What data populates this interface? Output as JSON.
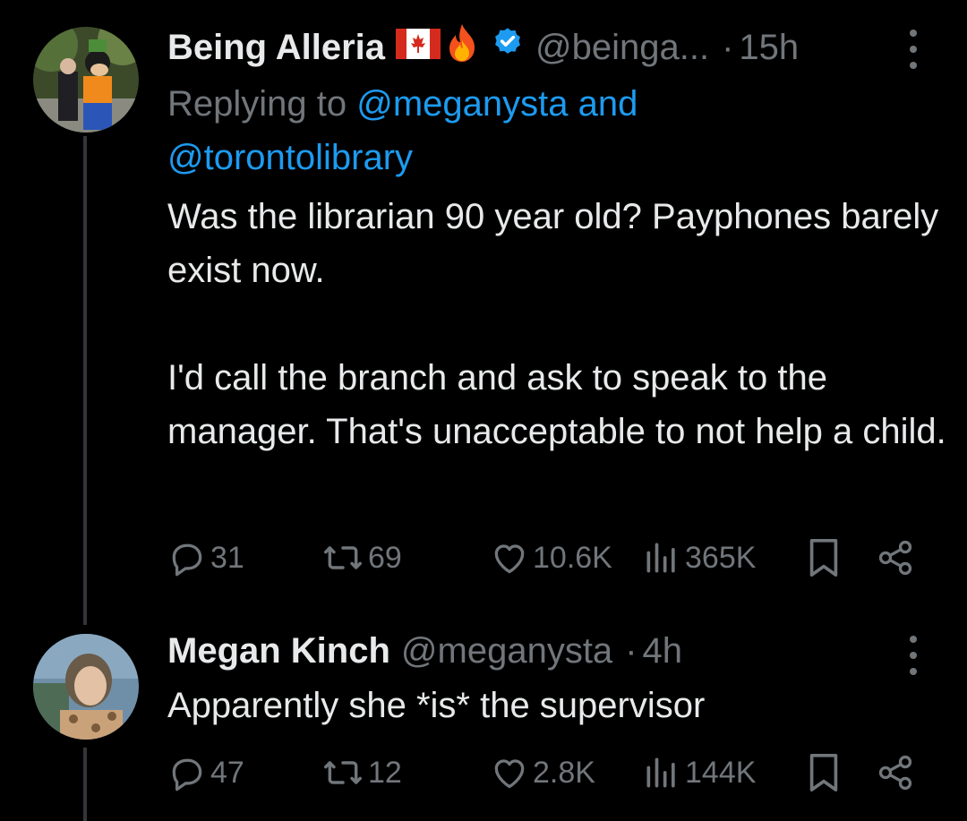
{
  "tweets": [
    {
      "author_name": "Being Alleria",
      "handle": "@beinga...",
      "separator": "·",
      "time": "15h",
      "replying_prefix": "Replying to",
      "replying_to_1": "@meganysta",
      "replying_and": "and",
      "replying_to_2": "@torontolibrary",
      "text_paragraphs": [
        "Was the librarian 90 year old? Payphones barely exist now.",
        "I'd call the branch and ask to speak to the manager. That's unacceptable to not help a child."
      ],
      "replies": "31",
      "reposts": "69",
      "likes": "10.6K",
      "views": "365K",
      "icons": [
        "canada-flag-icon",
        "fire-icon",
        "verified-badge-icon"
      ]
    },
    {
      "author_name": "Megan Kinch",
      "handle": "@meganysta",
      "separator": "·",
      "time": "4h",
      "text_paragraphs": [
        "Apparently she *is* the supervisor"
      ],
      "replies": "47",
      "reposts": "12",
      "likes": "2.8K",
      "views": "144K"
    }
  ],
  "colors": {
    "background": "#000000",
    "text_primary": "#e7e9ea",
    "text_secondary": "#71767b",
    "link": "#1d9bf0",
    "verified": "#1d9bf0",
    "thread_line": "#333639"
  }
}
